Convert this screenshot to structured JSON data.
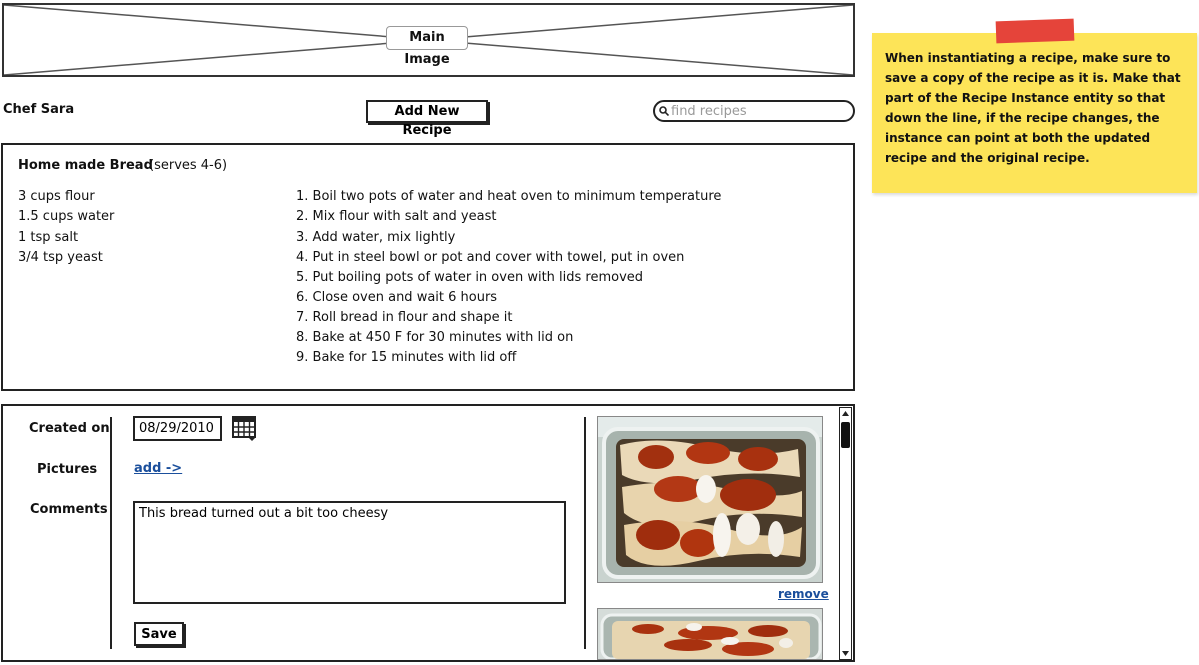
{
  "header": {
    "main_image_label": "Main Image",
    "chef_name": "Chef Sara",
    "add_recipe_label": "Add New Recipe",
    "search_placeholder": "find recipes"
  },
  "recipe": {
    "title": "Home made Bread",
    "serves": "(serves 4-6)",
    "ingredients": [
      "3 cups flour",
      "1.5 cups water",
      "1 tsp salt",
      "3/4 tsp yeast"
    ],
    "steps": [
      "1. Boil two pots of water and heat oven to minimum temperature",
      "2. Mix flour with salt and yeast",
      "3. Add water, mix lightly",
      "4. Put in steel bowl or pot and cover with towel, put in oven",
      "5. Put boiling pots of water in oven with lids removed",
      "6. Close oven and wait 6 hours",
      "7. Roll bread in flour and shape it",
      "8. Bake at 450 F for 30 minutes with lid on",
      "9. Bake for 15 minutes with lid off"
    ]
  },
  "instance": {
    "created_label": "Created on",
    "created_value": "08/29/2010",
    "pictures_label": "Pictures",
    "add_link": "add ->",
    "comments_label": "Comments",
    "comments_value": "This bread turned out a bit too cheesy",
    "save_label": "Save",
    "remove_link": "remove"
  },
  "note": {
    "text": "When instantiating a recipe, make sure to save a copy of the recipe as it is.  Make that part of the Recipe Instance entity so that down the line, if the recipe changes, the instance can point at both the updated recipe and the original recipe."
  },
  "colors": {
    "note_bg": "#fde458",
    "tape": "#e5443a",
    "link": "#1b4f9c"
  }
}
